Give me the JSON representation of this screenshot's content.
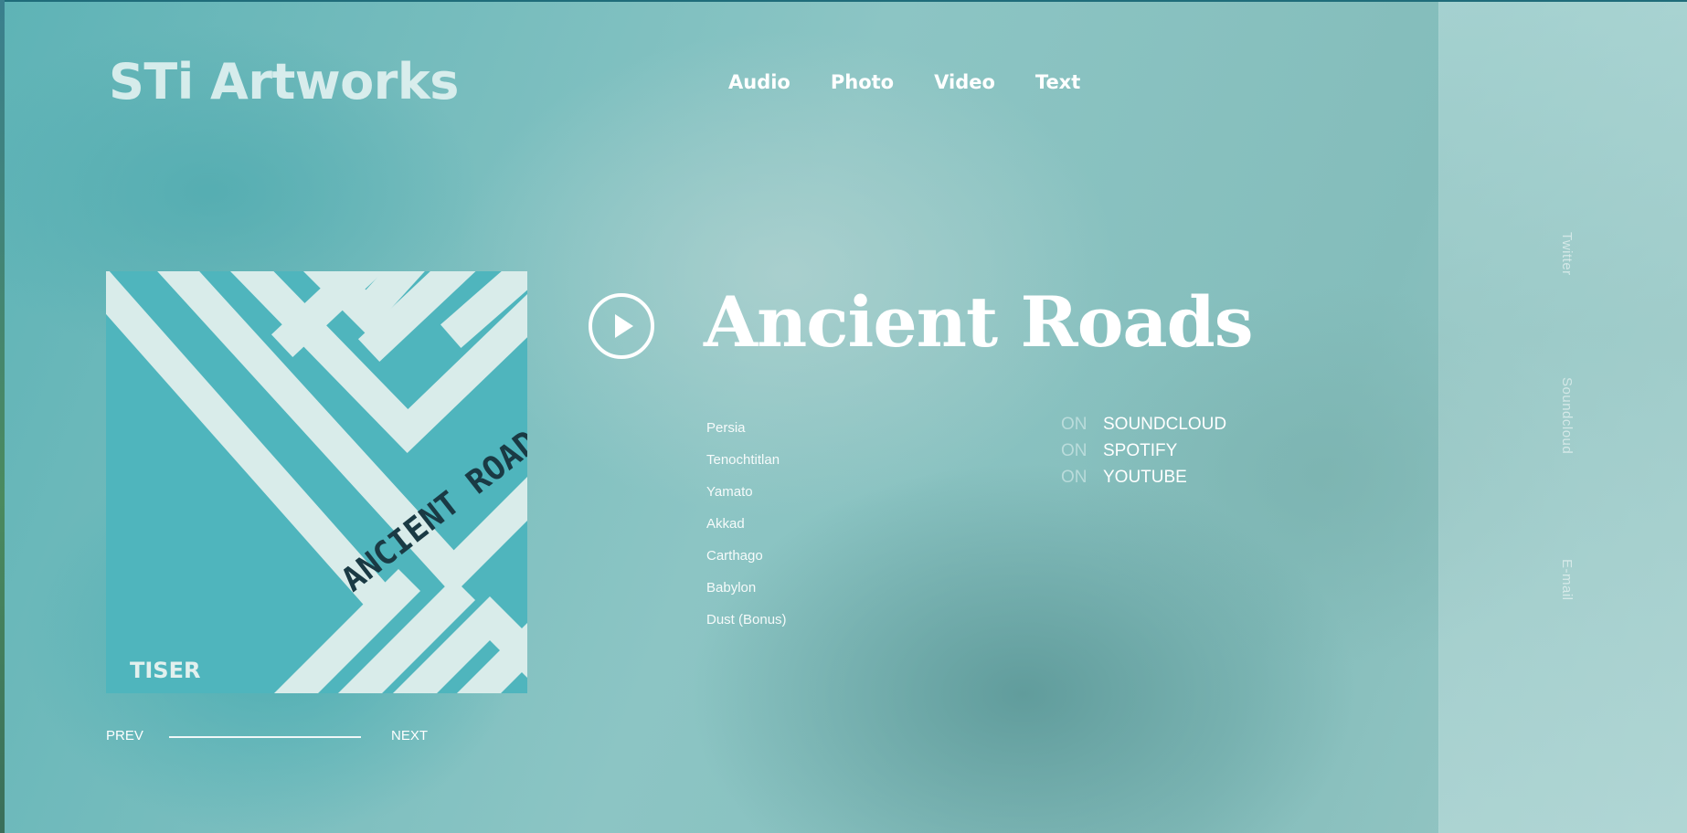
{
  "site": {
    "logo_text": "STi Artworks"
  },
  "nav": {
    "items": [
      {
        "label": "Audio"
      },
      {
        "label": "Photo"
      },
      {
        "label": "Video"
      },
      {
        "label": "Text"
      }
    ]
  },
  "album": {
    "title": "Ancient Roads",
    "cover": {
      "title_text": "ANCIENT ROADS",
      "artist_text": "TISER"
    },
    "tracks": [
      "Persia",
      "Tenochtitlan",
      "Yamato",
      "Akkad",
      "Carthago",
      "Babylon",
      "Dust (Bonus)"
    ],
    "platforms": [
      {
        "prefix": "ON",
        "name": "SOUNDCLOUD"
      },
      {
        "prefix": "ON",
        "name": "SPOTIFY"
      },
      {
        "prefix": "ON",
        "name": "YOUTUBE"
      }
    ]
  },
  "pager": {
    "prev_label": "PREV",
    "next_label": "NEXT"
  },
  "social": {
    "links": [
      "Twitter",
      "Soundcloud",
      "E-mail"
    ]
  },
  "icons": {
    "play": "play-circle-icon"
  },
  "colors": {
    "background_teal": "#8fc4c3",
    "cover_teal": "#4fb5bd",
    "text_white": "#ffffff"
  }
}
